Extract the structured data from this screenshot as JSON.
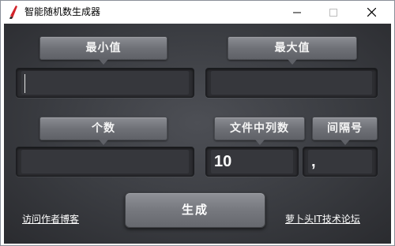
{
  "window": {
    "title": "智能随机数生成器",
    "controls": {
      "minimize": "—",
      "maximize": "☐",
      "close": "✕"
    }
  },
  "labels": {
    "min": "最小值",
    "max": "最大值",
    "count": "个数",
    "columns": "文件中列数",
    "separator": "间隔号"
  },
  "fields": {
    "min_value": "",
    "max_value": "",
    "count_value": "",
    "columns_value": "10",
    "separator_value": ","
  },
  "actions": {
    "generate": "生成",
    "visit_blog": "访问作者博客",
    "forum": "萝卜头IT技术论坛"
  },
  "colors": {
    "panel": "#3a3c41",
    "button": "#76787e",
    "field": "#2c2d31",
    "icon_red": "#d2232a"
  },
  "icons": {
    "app": "red-feather-icon"
  }
}
